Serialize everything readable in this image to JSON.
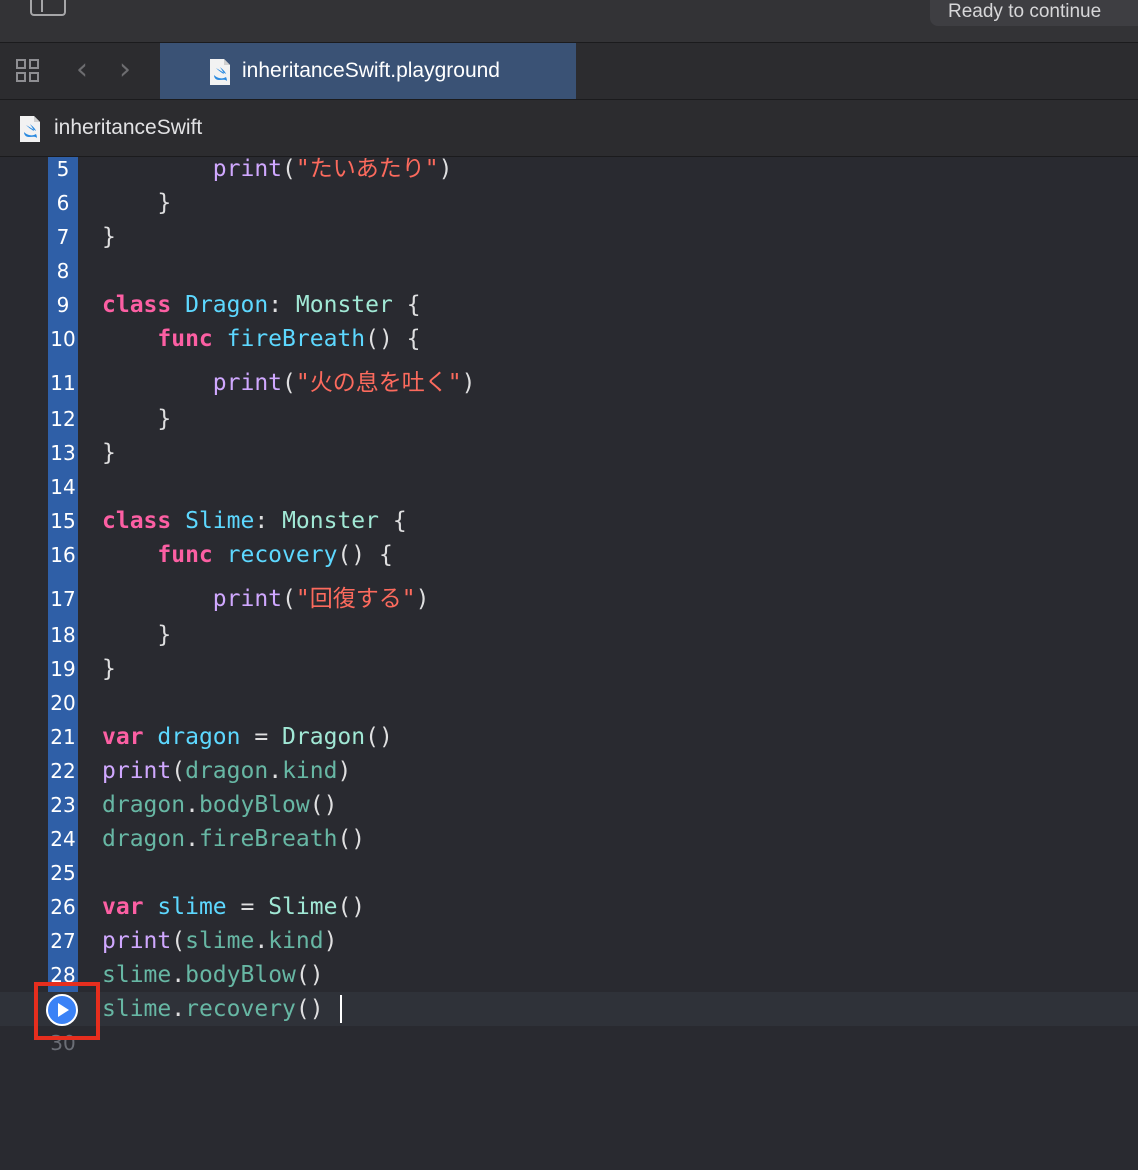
{
  "toolbar": {
    "status": "Ready to continue"
  },
  "tabs": [
    {
      "label": "inheritanceSwift.playground",
      "active": true
    }
  ],
  "breadcrumb": {
    "label": "inheritanceSwift"
  },
  "editor": {
    "current_line": 29,
    "lines": [
      {
        "n": "5",
        "tokens": [
          [
            "plain",
            "        "
          ],
          [
            "typ",
            "print"
          ],
          [
            "plain",
            "("
          ],
          [
            "str",
            "\"たいあたり\""
          ],
          [
            "plain",
            ")"
          ]
        ]
      },
      {
        "n": "6",
        "tokens": [
          [
            "plain",
            "    }"
          ]
        ]
      },
      {
        "n": "7",
        "tokens": [
          [
            "plain",
            "}"
          ]
        ]
      },
      {
        "n": "8",
        "tokens": []
      },
      {
        "n": "9",
        "tokens": [
          [
            "kw",
            "class"
          ],
          [
            "plain",
            " "
          ],
          [
            "decl",
            "Dragon"
          ],
          [
            "plain",
            ": "
          ],
          [
            "proj",
            "Monster"
          ],
          [
            "plain",
            " {"
          ]
        ]
      },
      {
        "n": "10",
        "tokens": [
          [
            "plain",
            "    "
          ],
          [
            "kw",
            "func"
          ],
          [
            "plain",
            " "
          ],
          [
            "decl",
            "fireBreath"
          ],
          [
            "plain",
            "() {"
          ]
        ]
      },
      {
        "n": "11",
        "tokens": [
          [
            "plain",
            "        "
          ],
          [
            "typ",
            "print"
          ],
          [
            "plain",
            "("
          ],
          [
            "str",
            "\"火の息を吐く\""
          ],
          [
            "plain",
            ")"
          ]
        ]
      },
      {
        "n": "12",
        "tokens": [
          [
            "plain",
            "    }"
          ]
        ]
      },
      {
        "n": "13",
        "tokens": [
          [
            "plain",
            "}"
          ]
        ]
      },
      {
        "n": "14",
        "tokens": []
      },
      {
        "n": "15",
        "tokens": [
          [
            "kw",
            "class"
          ],
          [
            "plain",
            " "
          ],
          [
            "decl",
            "Slime"
          ],
          [
            "plain",
            ": "
          ],
          [
            "proj",
            "Monster"
          ],
          [
            "plain",
            " {"
          ]
        ]
      },
      {
        "n": "16",
        "tokens": [
          [
            "plain",
            "    "
          ],
          [
            "kw",
            "func"
          ],
          [
            "plain",
            " "
          ],
          [
            "decl",
            "recovery"
          ],
          [
            "plain",
            "() {"
          ]
        ]
      },
      {
        "n": "17",
        "tokens": [
          [
            "plain",
            "        "
          ],
          [
            "typ",
            "print"
          ],
          [
            "plain",
            "("
          ],
          [
            "str",
            "\"回復する\""
          ],
          [
            "plain",
            ")"
          ]
        ]
      },
      {
        "n": "18",
        "tokens": [
          [
            "plain",
            "    }"
          ]
        ]
      },
      {
        "n": "19",
        "tokens": [
          [
            "plain",
            "}"
          ]
        ]
      },
      {
        "n": "20",
        "tokens": []
      },
      {
        "n": "21",
        "tokens": [
          [
            "kw",
            "var"
          ],
          [
            "plain",
            " "
          ],
          [
            "decl",
            "dragon"
          ],
          [
            "plain",
            " = "
          ],
          [
            "proj",
            "Dragon"
          ],
          [
            "plain",
            "()"
          ]
        ]
      },
      {
        "n": "22",
        "tokens": [
          [
            "typ",
            "print"
          ],
          [
            "plain",
            "("
          ],
          [
            "var",
            "dragon"
          ],
          [
            "plain",
            "."
          ],
          [
            "var",
            "kind"
          ],
          [
            "plain",
            ")"
          ]
        ]
      },
      {
        "n": "23",
        "tokens": [
          [
            "var",
            "dragon"
          ],
          [
            "plain",
            "."
          ],
          [
            "fn",
            "bodyBlow"
          ],
          [
            "plain",
            "()"
          ]
        ]
      },
      {
        "n": "24",
        "tokens": [
          [
            "var",
            "dragon"
          ],
          [
            "plain",
            "."
          ],
          [
            "fn",
            "fireBreath"
          ],
          [
            "plain",
            "()"
          ]
        ]
      },
      {
        "n": "25",
        "tokens": []
      },
      {
        "n": "26",
        "tokens": [
          [
            "kw",
            "var"
          ],
          [
            "plain",
            " "
          ],
          [
            "decl",
            "slime"
          ],
          [
            "plain",
            " = "
          ],
          [
            "proj",
            "Slime"
          ],
          [
            "plain",
            "()"
          ]
        ]
      },
      {
        "n": "27",
        "tokens": [
          [
            "typ",
            "print"
          ],
          [
            "plain",
            "("
          ],
          [
            "var",
            "slime"
          ],
          [
            "plain",
            "."
          ],
          [
            "var",
            "kind"
          ],
          [
            "plain",
            ")"
          ]
        ]
      },
      {
        "n": "28",
        "tokens": [
          [
            "var",
            "slime"
          ],
          [
            "plain",
            "."
          ],
          [
            "fn",
            "bodyBlow"
          ],
          [
            "plain",
            "()"
          ]
        ]
      },
      {
        "n": "29",
        "tokens": [
          [
            "var",
            "slime"
          ],
          [
            "plain",
            "."
          ],
          [
            "fn",
            "recovery"
          ],
          [
            "plain",
            "()"
          ]
        ]
      },
      {
        "n": "30",
        "tokens": []
      }
    ]
  },
  "colors": {
    "gutter_highlight": "#2f5fa7",
    "tab_active": "#3a5275",
    "annotation_box": "#e62e1e",
    "run_button": "#3b82f6"
  },
  "icons": [
    "sidebar-icon",
    "grid-icon",
    "chevron-left-icon",
    "chevron-right-icon",
    "swift-file-icon",
    "play-icon"
  ]
}
